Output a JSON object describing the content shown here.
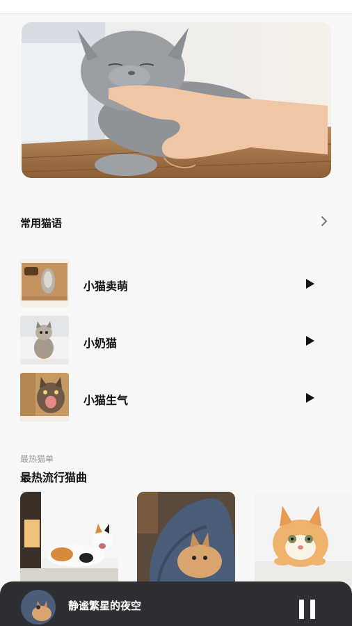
{
  "hero": {
    "image": "gray-cat-being-petted"
  },
  "common_cat_words": {
    "title": "常用猫语",
    "more_icon": "chevron-right-icon",
    "items": [
      {
        "label": "小猫卖萌",
        "image": "cat-paw-in-box",
        "action_icon": "play-icon"
      },
      {
        "label": "小奶猫",
        "image": "kitten-sitting",
        "action_icon": "play-icon"
      },
      {
        "label": "小猫生气",
        "image": "angry-kitten",
        "action_icon": "play-icon"
      }
    ]
  },
  "hot_songs": {
    "subtitle": "最热猫单",
    "title": "最热流行猫曲",
    "cards": [
      {
        "image": "calico-cat-lying"
      },
      {
        "image": "kitten-in-blanket"
      },
      {
        "image": "orange-kitten-on-rug"
      }
    ]
  },
  "player": {
    "title": "静谧繁星的夜空",
    "control_icon": "pause-icon",
    "colors": {
      "bar": "#2d2f33"
    }
  }
}
